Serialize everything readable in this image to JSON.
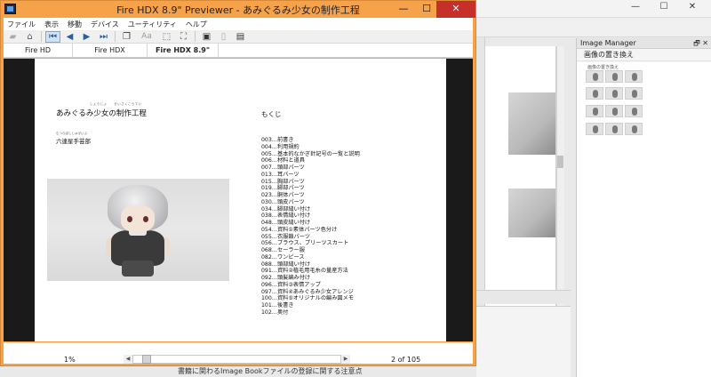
{
  "window": {
    "title": "Fire HDX 8.9\" Previewer - あみぐるみ少女の制作工程",
    "controls": {
      "minimize": "—",
      "maximize": "☐",
      "close": "✕"
    }
  },
  "menu": [
    "ファイル",
    "表示",
    "移動",
    "デバイス",
    "ユーティリティ",
    "ヘルプ"
  ],
  "toolbar": {
    "font_size_label": "Aa"
  },
  "tabs": [
    {
      "label": "Fire HD"
    },
    {
      "label": "Fire HDX"
    },
    {
      "label": "Fire HDX 8.9\"",
      "active": true
    }
  ],
  "page": {
    "title": "あみぐるみ少女の制作工程",
    "title_ruby": "しょうじょ　　せいさくこうてい",
    "author": "六連星手芸部",
    "author_ruby": "むつらぼししゅげいぶ",
    "toc_heading": "もくじ",
    "toc": [
      "003…前書き",
      "004…利用規約",
      "005…基本的なかぎ針記号の一覧と説明",
      "006…材料と道具",
      "007…頭部パーツ",
      "013…耳パーツ",
      "015…胸部パーツ",
      "019…脚部パーツ",
      "023…胴体パーツ",
      "030…頭皮パーツ",
      "034…脚部縫い付け",
      "038…表情縫い付け",
      "048…頭皮縫い付け",
      "054…資料①素体パーツ色分け",
      "055…衣服鎖パーツ",
      "056…ブラウス、プリーツスカート",
      "068…セーラー服",
      "082…ワンピース",
      "088…頭部縫い付け",
      "091…資料②植毛用毛糸の量産方法",
      "092…頭髪編み付け",
      "096…資料③表情アップ",
      "097…資料④あみぐるみ少女アレンジ",
      "100…資料⑤オリジナルの編み図メモ",
      "101…後書き",
      "102…奥付"
    ]
  },
  "status": {
    "zoom": "1%",
    "page_info": "2 of 105"
  },
  "image_manager": {
    "title": "Image Manager",
    "controls": "🗗 ✕",
    "action": "画像の置き換え",
    "caption": "画像の置き換え"
  },
  "background": {
    "footer_text": "書籍に関わるImage Bookファイルの登録に関する注意点"
  },
  "colors": {
    "window_border": "#f5a24a",
    "close_button": "#c7302a",
    "active_tool": "#cfe3f7"
  }
}
